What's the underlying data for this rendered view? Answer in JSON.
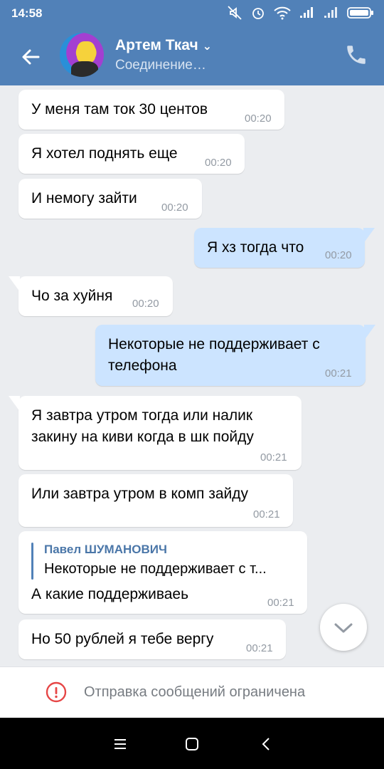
{
  "status_bar": {
    "time": "14:58"
  },
  "header": {
    "contact_name": "Артем Ткач",
    "contact_status": "Соединение…"
  },
  "messages": [
    {
      "dir": "in",
      "text": "У меня там ток 30 центов",
      "time": "00:20"
    },
    {
      "dir": "in",
      "text": "Я хотел поднять еще",
      "time": "00:20"
    },
    {
      "dir": "in",
      "text": "И немогу зайти",
      "time": "00:20"
    },
    {
      "dir": "out",
      "text": "Я хз тогда что",
      "time": "00:20"
    },
    {
      "dir": "in",
      "text": "Чо за хуйня",
      "time": "00:20"
    },
    {
      "dir": "out",
      "line1": "Некоторые не поддерживает с",
      "line2": "телефона",
      "time": "00:21"
    },
    {
      "dir": "in",
      "line1": "Я завтра утром тогда или налик",
      "line2": "закину на киви когда в шк пойду",
      "time": "00:21"
    },
    {
      "dir": "in",
      "text": "Или завтра утром в комп зайду",
      "time": "00:21"
    },
    {
      "dir": "in",
      "reply_author": "Павел ШУМАНОВИЧ",
      "reply_text": "Некоторые не поддерживает с т...",
      "text": "А какие поддерживаеь",
      "time": "00:21"
    },
    {
      "dir": "in",
      "text": "Но 50 рублей я тебе вергу",
      "time": "00:21"
    }
  ],
  "footer": {
    "restriction_text": "Отправка сообщений ограничена"
  },
  "colors": {
    "accent": "#5181b8",
    "outgoing_bubble": "#cce4ff",
    "background": "#ebedf0"
  }
}
